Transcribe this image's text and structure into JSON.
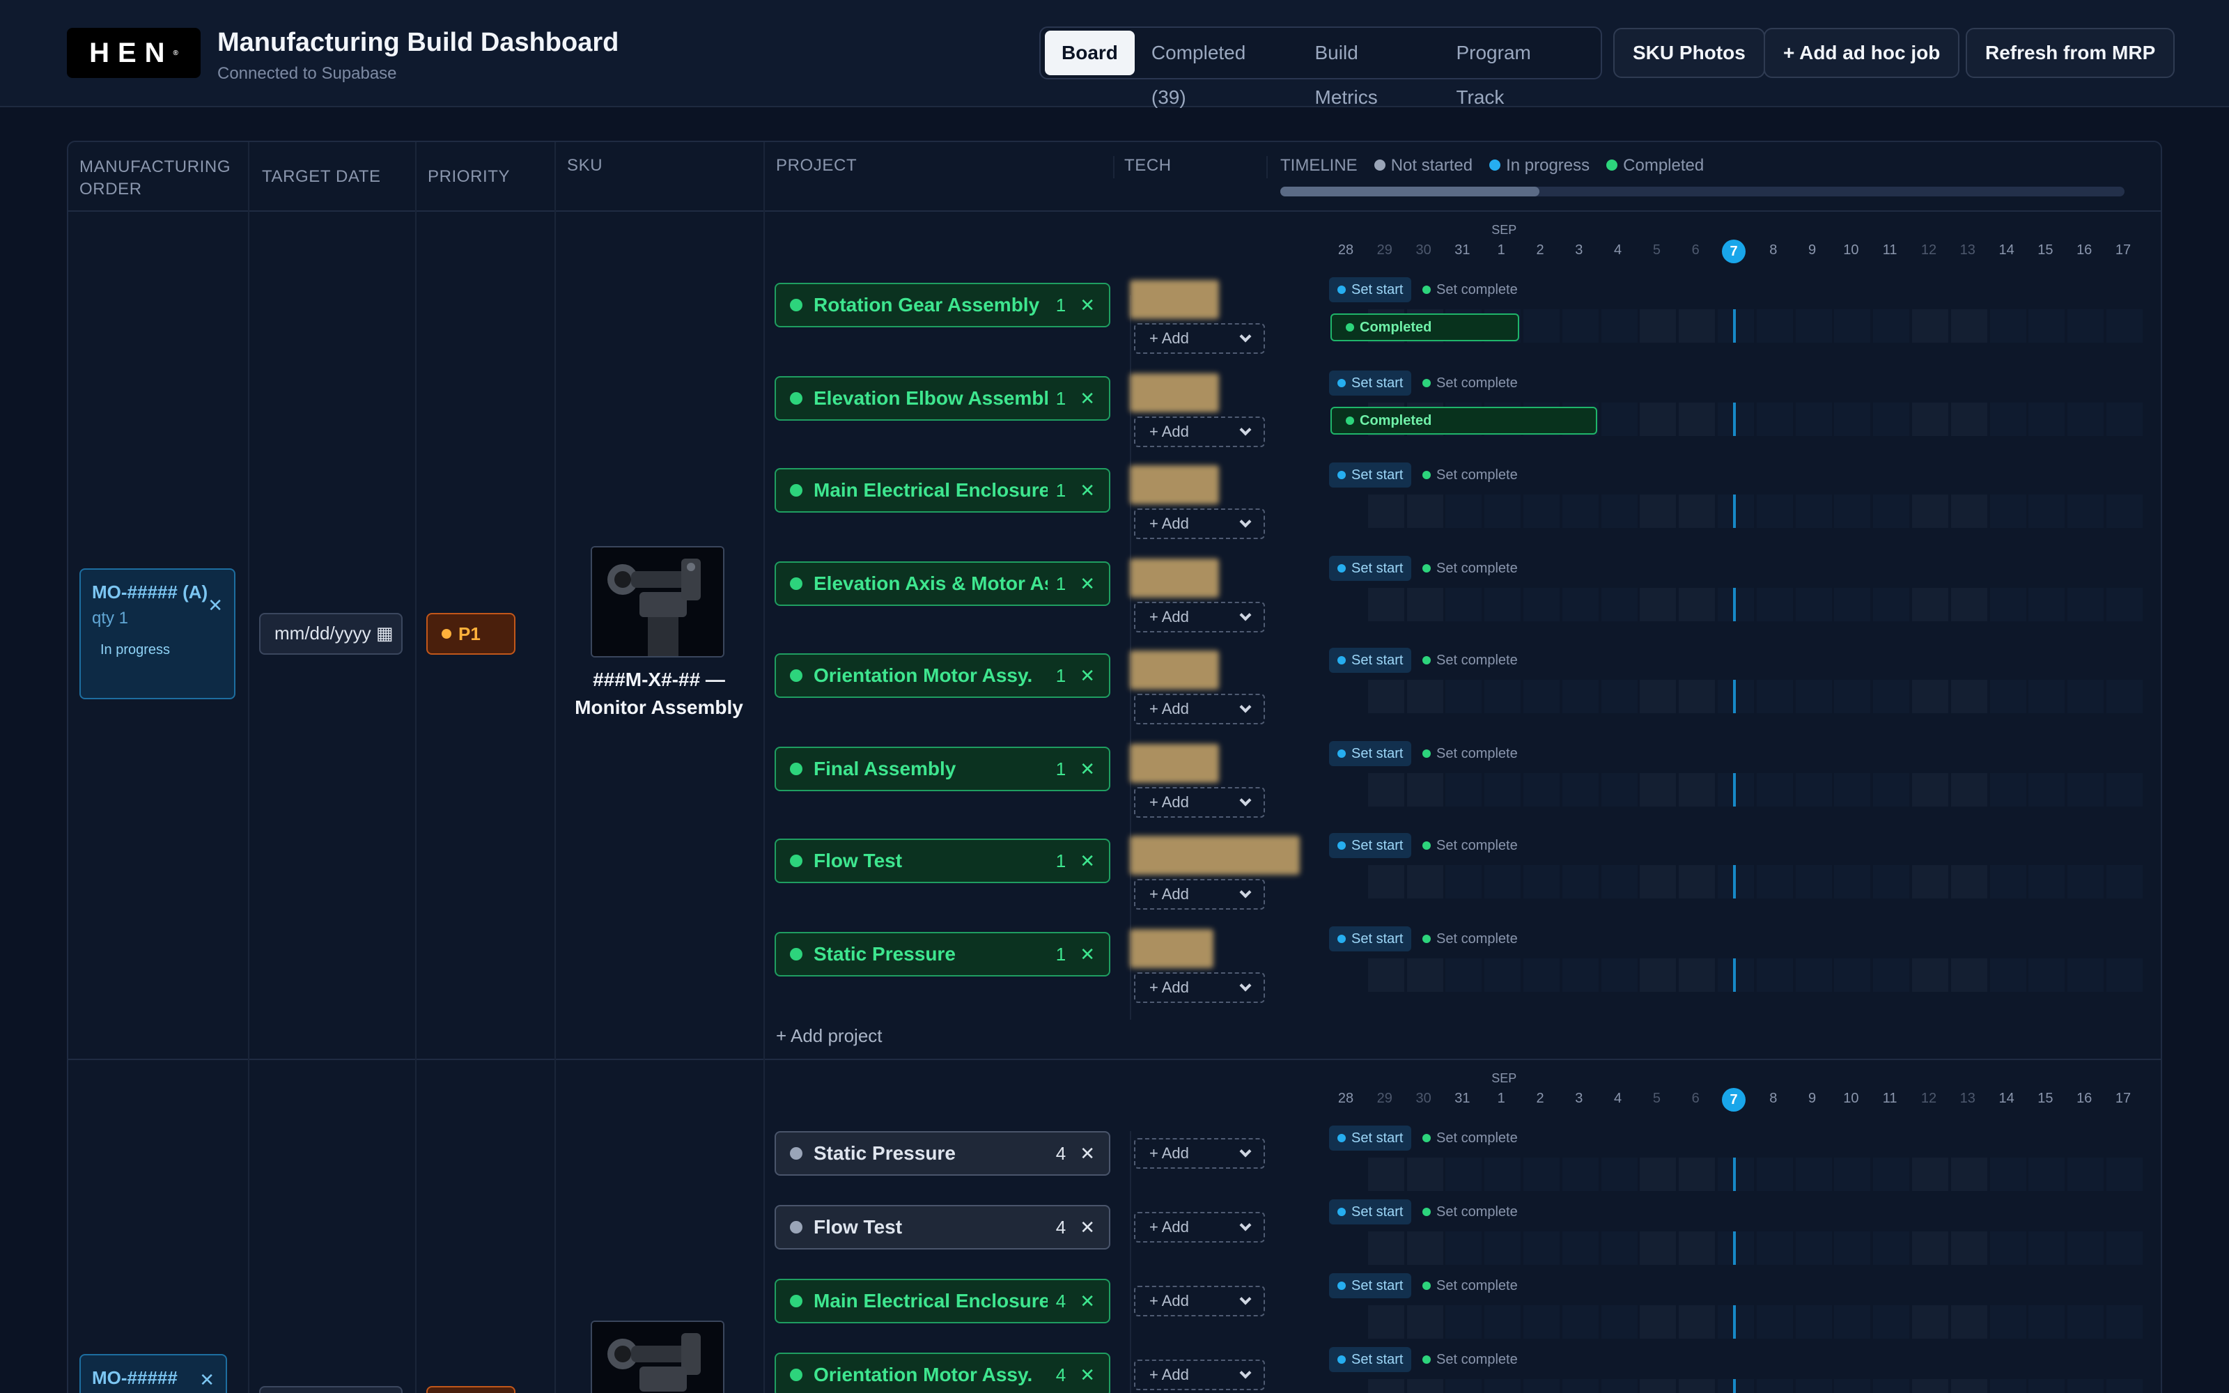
{
  "header": {
    "logo_text": "HEN",
    "title": "Manufacturing Build Dashboard",
    "subtitle": "Connected to Supabase",
    "tabs": [
      "Board",
      "Completed (39)",
      "Build Metrics",
      "Program Track"
    ],
    "active_tab": "Board",
    "buttons": {
      "sku_photos": "SKU Photos",
      "add_adhoc": "+ Add ad hoc job",
      "refresh": "Refresh from MRP"
    }
  },
  "columns": {
    "mo_line1": "MANUFACTURING",
    "mo_line2": "ORDER",
    "target_date": "TARGET DATE",
    "priority": "PRIORITY",
    "sku": "SKU",
    "project": "PROJECT",
    "tech": "TECH",
    "timeline": "TIMELINE"
  },
  "legend": {
    "not_started": "Not started",
    "in_progress": "In progress",
    "completed": "Completed"
  },
  "colors": {
    "not_started": "#9aa5b8",
    "in_progress": "#26aef0",
    "completed": "#2dd47c"
  },
  "timeline": {
    "month": "SEP",
    "days": [
      "28",
      "29",
      "30",
      "31",
      "1",
      "2",
      "3",
      "4",
      "5",
      "6",
      "7",
      "8",
      "9",
      "10",
      "11",
      "12",
      "13",
      "14",
      "15",
      "16",
      "17"
    ],
    "weekend_days": [
      "29",
      "30",
      "5",
      "6",
      "12",
      "13"
    ],
    "today": "7",
    "set_start_label": "Set start",
    "set_complete_label": "Set complete",
    "completed_label": "Completed"
  },
  "orders": [
    {
      "mo_id": "MO-##### (A)",
      "qty": "qty 1",
      "status": "In progress",
      "date_placeholder": "mm/dd/yyyy",
      "priority": "P1",
      "sku_name": "###M-X#-## — Monitor Assembly",
      "add_project": "+ Add project",
      "projects": [
        {
          "name": "Rotation Gear Assembly",
          "qty": "1",
          "state": "completed",
          "done": true,
          "done_span_days": 5
        },
        {
          "name": "Elevation Elbow Assembly",
          "qty": "1",
          "state": "completed",
          "done": true,
          "done_span_days": 7
        },
        {
          "name": "Main Electrical Enclosure ...",
          "qty": "1",
          "state": "completed",
          "done": false
        },
        {
          "name": "Elevation Axis & Motor As...",
          "qty": "1",
          "state": "completed",
          "done": false
        },
        {
          "name": "Orientation Motor Assy.",
          "qty": "1",
          "state": "completed",
          "done": false
        },
        {
          "name": "Final Assembly",
          "qty": "1",
          "state": "completed",
          "done": false
        },
        {
          "name": "Flow Test",
          "qty": "1",
          "state": "completed",
          "done": false
        },
        {
          "name": "Static Pressure",
          "qty": "1",
          "state": "completed",
          "done": false
        }
      ],
      "tech_add": "+ Add"
    },
    {
      "mo_id": "MO-#####",
      "projects": [
        {
          "name": "Static Pressure",
          "qty": "4",
          "state": "not_started"
        },
        {
          "name": "Flow Test",
          "qty": "4",
          "state": "not_started"
        },
        {
          "name": "Main Electrical Enclosure ...",
          "qty": "4",
          "state": "completed"
        },
        {
          "name": "Orientation Motor Assy.",
          "qty": "4",
          "state": "completed"
        }
      ],
      "tech_add": "+ Add"
    }
  ]
}
